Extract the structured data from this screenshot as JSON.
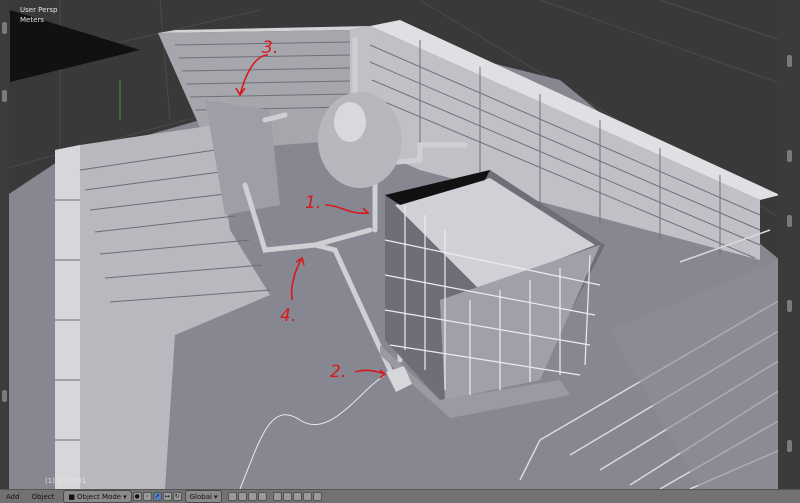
{
  "viewport": {
    "view_name": "User Persp",
    "units": "Meters",
    "frame_label": "(1) Sun.001"
  },
  "annotations": [
    "1.",
    "2.",
    "3.",
    "4."
  ],
  "header": {
    "menus": [
      "Add",
      "Object"
    ],
    "mode": "Object Mode",
    "orientation": "Global"
  },
  "colors": {
    "annotation": "#d8191b",
    "wall": "#b3b3b9",
    "floor": "#878791"
  }
}
